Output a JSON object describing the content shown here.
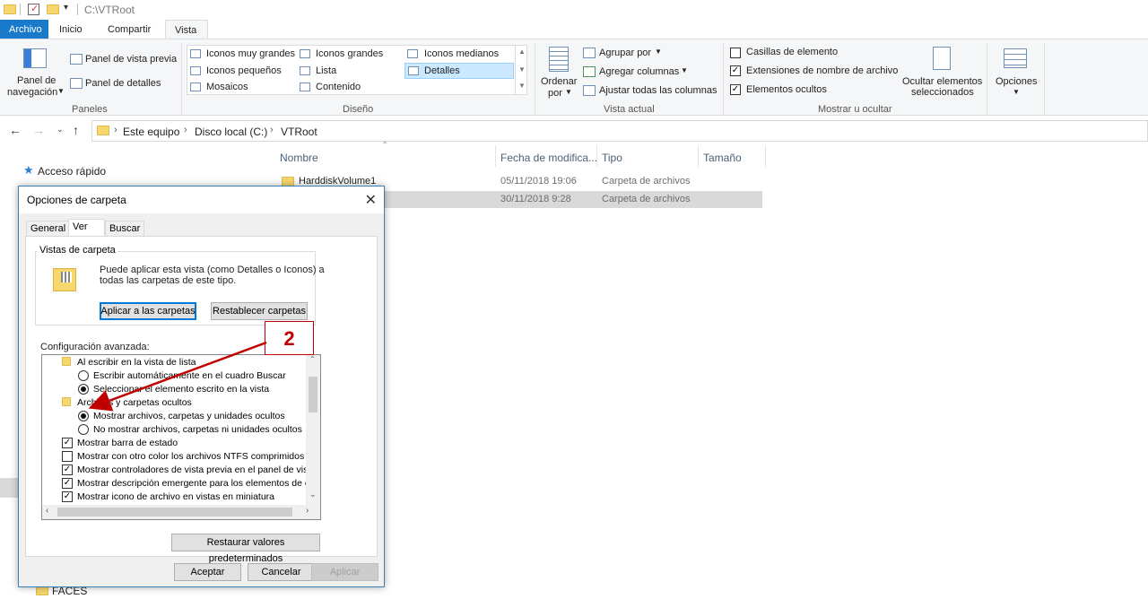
{
  "titlebar": {
    "path": "C:\\VTRoot"
  },
  "ribbon_tabs": [
    "Archivo",
    "Inicio",
    "Compartir",
    "Vista"
  ],
  "ribbon": {
    "panes": {
      "nav_label_1": "Panel de",
      "nav_label_2": "navegación",
      "preview": "Panel de vista previa",
      "details": "Panel de detalles",
      "group": "Paneles"
    },
    "layout": {
      "items": [
        "Iconos muy grandes",
        "Iconos grandes",
        "Iconos medianos",
        "Iconos pequeños",
        "Lista",
        "Detalles",
        "Mosaicos",
        "Contenido"
      ],
      "group": "Diseño"
    },
    "current_view": {
      "sort_1": "Ordenar",
      "sort_2": "por",
      "group_by": "Agrupar por",
      "add_columns": "Agregar columnas",
      "fit_columns": "Ajustar todas las columnas",
      "group": "Vista actual"
    },
    "show_hide": {
      "checkboxes": "Casillas de elemento",
      "extensions": "Extensiones de nombre de archivo",
      "hidden": "Elementos ocultos",
      "hide_selected_1": "Ocultar elementos",
      "hide_selected_2": "seleccionados",
      "group": "Mostrar u ocultar"
    },
    "options": "Opciones"
  },
  "address": {
    "crumbs": [
      "Este equipo",
      "Disco local (C:)",
      "VTRoot"
    ]
  },
  "file_list": {
    "columns": [
      "Nombre",
      "Fecha de modifica...",
      "Tipo",
      "Tamaño"
    ],
    "rows": [
      {
        "name": "HarddiskVolume1",
        "date": "05/11/2018 19:06",
        "type": "Carpeta de archivos"
      },
      {
        "name": "",
        "date": "30/11/2018 9:28",
        "type": "Carpeta de archivos"
      }
    ]
  },
  "nav_pane": {
    "quick_access": "Acceso rápido",
    "faces": "FACES"
  },
  "dialog": {
    "title": "Opciones de carpeta",
    "tabs": [
      "General",
      "Ver",
      "Buscar"
    ],
    "folder_views_label": "Vistas de carpeta",
    "folder_views_desc_1": "Puede aplicar esta vista (como Detalles o Iconos) a",
    "folder_views_desc_2": "todas las carpetas de este tipo.",
    "apply_folders": "Aplicar a las carpetas",
    "reset_folders": "Restablecer carpetas",
    "advanced_label": "Configuración avanzada:",
    "advanced_items": [
      "Al escribir en la vista de lista",
      "Escribir automáticamente en el cuadro Buscar",
      "Seleccionar el elemento escrito en la vista",
      "Archivos y carpetas ocultos",
      "Mostrar archivos, carpetas y unidades ocultos",
      "No mostrar archivos, carpetas ni unidades ocultos",
      "Mostrar barra de estado",
      "Mostrar con otro color los archivos NTFS comprimidos o c",
      "Mostrar controladores de vista previa en el panel de vista",
      "Mostrar descripción emergente para los elementos de car",
      "Mostrar icono de archivo en vistas en miniatura"
    ],
    "restore_defaults": "Restaurar valores predeterminados",
    "ok": "Aceptar",
    "cancel": "Cancelar",
    "apply": "Aplicar"
  },
  "annotation": {
    "label": "2",
    "color": "#c00000"
  },
  "colors": {
    "accent": "#1979ca",
    "selection": "#cce8ff",
    "annotation": "#c00000"
  }
}
